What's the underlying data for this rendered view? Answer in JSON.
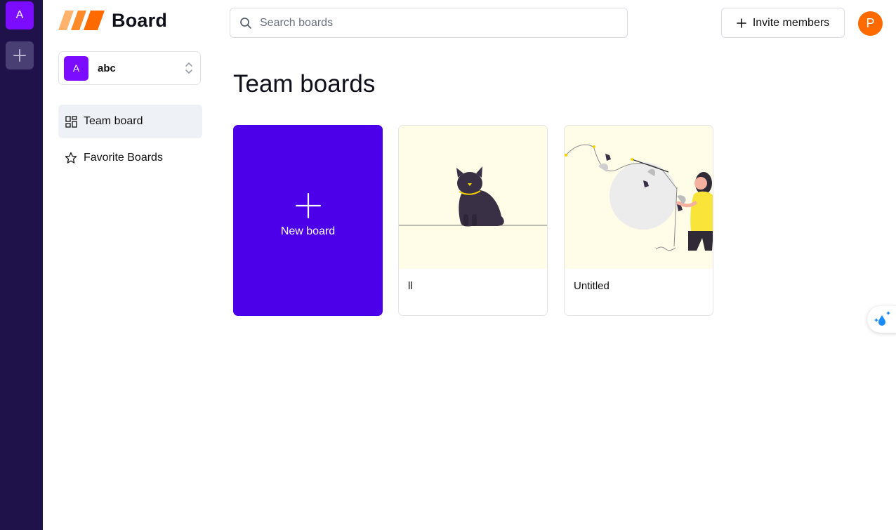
{
  "rail": {
    "org_initial": "A"
  },
  "brand": {
    "name": "Board"
  },
  "org": {
    "initial": "A",
    "name": "abc"
  },
  "nav": [
    {
      "label": "Team board",
      "icon": "dashboard-icon",
      "active": true
    },
    {
      "label": "Favorite Boards",
      "icon": "star-icon",
      "active": false
    }
  ],
  "search": {
    "placeholder": "Search boards",
    "value": ""
  },
  "invite": {
    "label": "Invite members"
  },
  "user": {
    "initial": "P"
  },
  "main": {
    "title": "Team boards",
    "new_board_label": "New board",
    "boards": [
      {
        "title": "ll",
        "thumbnail": "cat-illustration"
      },
      {
        "title": "Untitled",
        "thumbnail": "woman-fishing-illustration"
      }
    ]
  },
  "colors": {
    "rail_bg": "#1f1149",
    "org_purple": "#7c0cff",
    "new_board_bg": "#4c00ea",
    "user_avatar": "#ff6a00",
    "logo_orange": "#ff7a1a",
    "thumb_bg": "#fffde7"
  }
}
